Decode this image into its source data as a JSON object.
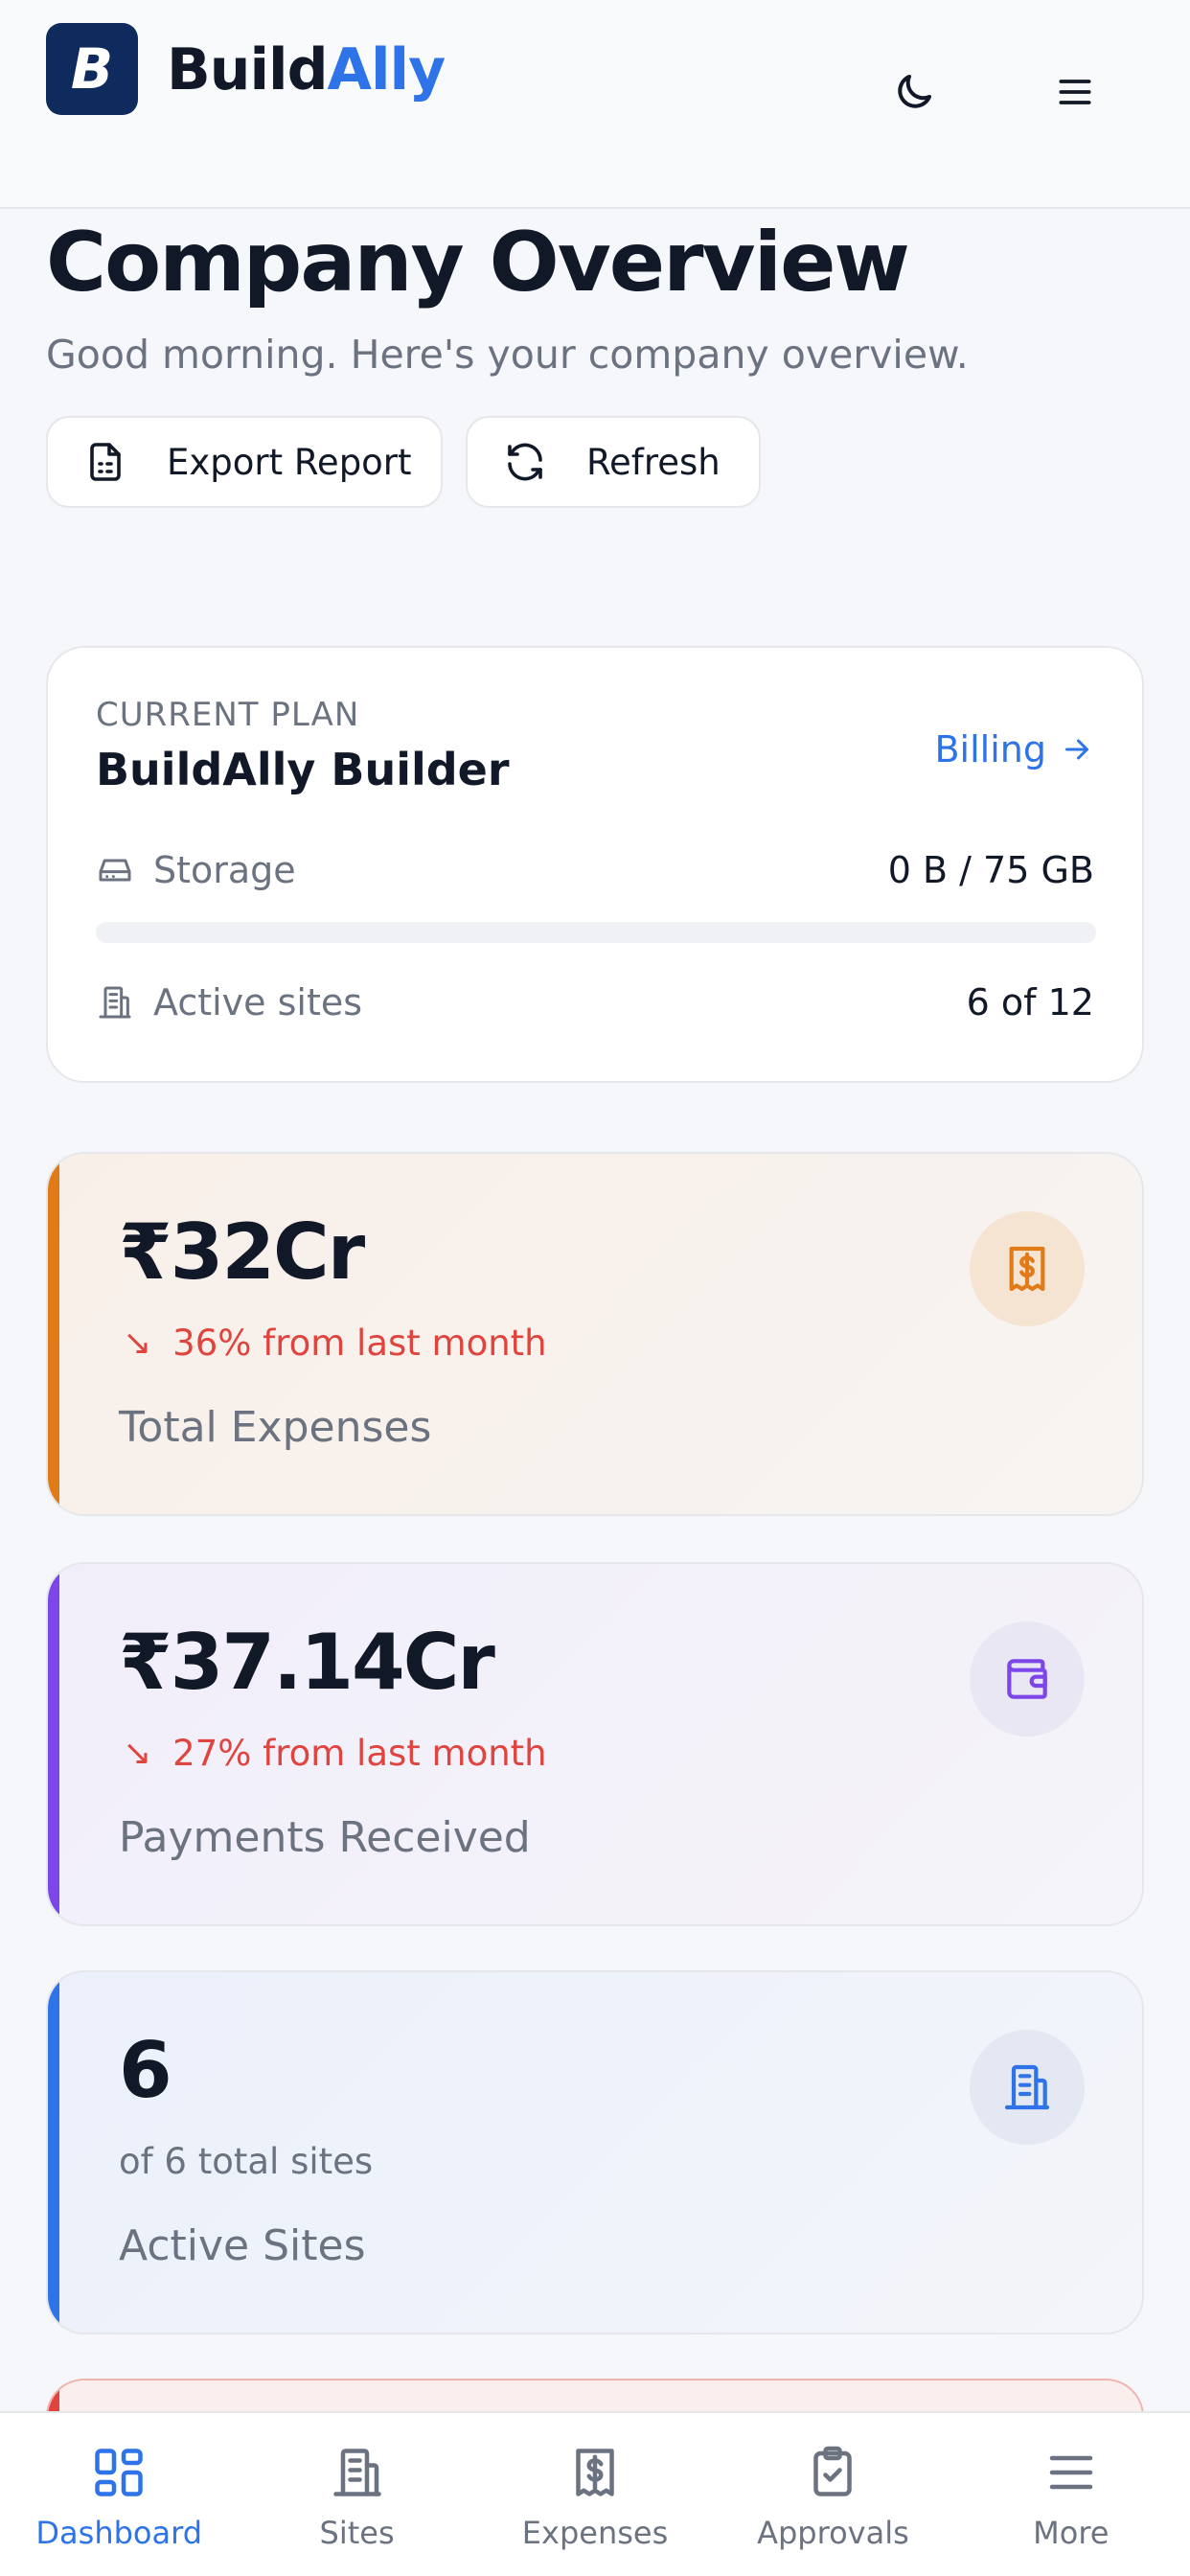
{
  "header": {
    "logo_letter": "B",
    "brand_part1": "Build",
    "brand_part2": "Ally",
    "theme_icon": "moon-icon",
    "menu_icon": "hamburger-menu-icon"
  },
  "page": {
    "title": "Company Overview",
    "subtitle": "Good morning. Here's your company overview.",
    "actions": {
      "export_label": "Export Report",
      "refresh_label": "Refresh"
    }
  },
  "plan": {
    "label": "CURRENT PLAN",
    "name": "BuildAlly Builder",
    "billing_link": "Billing",
    "storage_label": "Storage",
    "storage_value": "0 B / 75 GB",
    "storage_used_fraction": 0,
    "sites_label": "Active sites",
    "sites_value": "6 of 12"
  },
  "stats": {
    "expenses": {
      "value": "₹32Cr",
      "delta": "36% from last month",
      "label": "Total Expenses",
      "icon": "receipt-dollar-icon",
      "accent": "#e07b18"
    },
    "payments": {
      "value": "₹37.14Cr",
      "delta": "27% from last month",
      "label": "Payments Received",
      "icon": "wallet-icon",
      "accent": "#7c46e8"
    },
    "sites": {
      "value": "6",
      "sub": "of 6 total sites",
      "label": "Active Sites",
      "icon": "building-icon",
      "accent": "#2f73e8"
    }
  },
  "nav": {
    "items": [
      {
        "label": "Dashboard",
        "icon": "dashboard-grid-icon",
        "active": true
      },
      {
        "label": "Sites",
        "icon": "building-icon",
        "active": false
      },
      {
        "label": "Expenses",
        "icon": "receipt-dollar-icon",
        "active": false
      },
      {
        "label": "Approvals",
        "icon": "clipboard-check-icon",
        "active": false
      },
      {
        "label": "More",
        "icon": "menu-icon",
        "active": false
      }
    ]
  },
  "colors": {
    "brand_blue": "#2f73e8",
    "negative_red": "#e0443e",
    "text_dark": "#111827",
    "text_muted": "#6b7280"
  }
}
